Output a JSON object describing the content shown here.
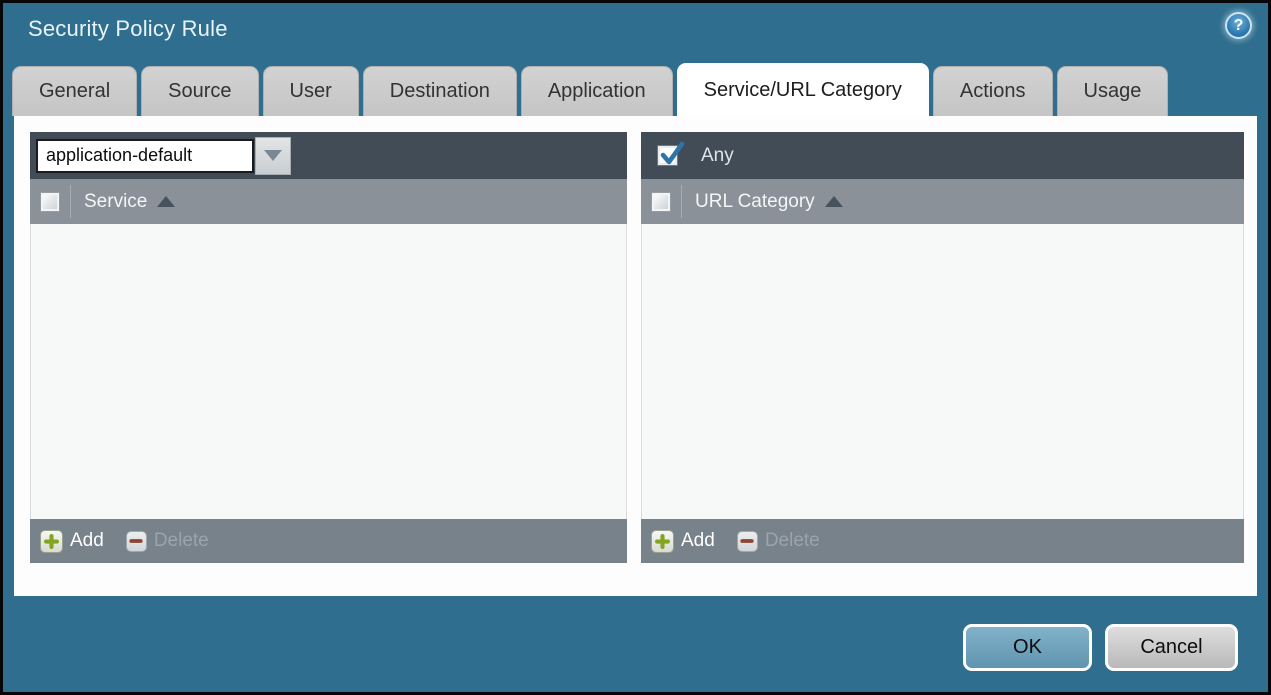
{
  "window": {
    "title": "Security Policy Rule",
    "help_icon_glyph": "?"
  },
  "tabs": [
    "General",
    "Source",
    "User",
    "Destination",
    "Application",
    "Service/URL Category",
    "Actions",
    "Usage"
  ],
  "active_tab": "Service/URL Category",
  "service_panel": {
    "dropdown": {
      "value": "application-default"
    },
    "header": {
      "column": "Service",
      "sort": "ascending",
      "checkbox_checked": false
    },
    "rows": [],
    "footer": {
      "add_label": "Add",
      "delete_label": "Delete",
      "delete_enabled": false
    }
  },
  "url_category_panel": {
    "any": {
      "label": "Any",
      "checked": true
    },
    "header": {
      "column": "URL Category",
      "sort": "ascending",
      "checkbox_checked": false
    },
    "rows": [],
    "footer": {
      "add_label": "Add",
      "delete_label": "Delete",
      "delete_enabled": false
    }
  },
  "dialog_buttons": {
    "ok": "OK",
    "cancel": "Cancel"
  },
  "colors": {
    "dialog_background": "#2f6e8e",
    "toolbar_dark": "#414c56",
    "table_header_gray": "#8a9199",
    "table_footer_gray": "#78828b",
    "active_tab": "#ffffff",
    "inactive_tab": "#c9c9c9",
    "add_plus_green": "#82a41f",
    "delete_minus_red": "#8c4333",
    "check_blue": "#2f74a8",
    "ok_button_blue": "#6fa3bd",
    "cancel_button_gray": "#cccccc"
  }
}
